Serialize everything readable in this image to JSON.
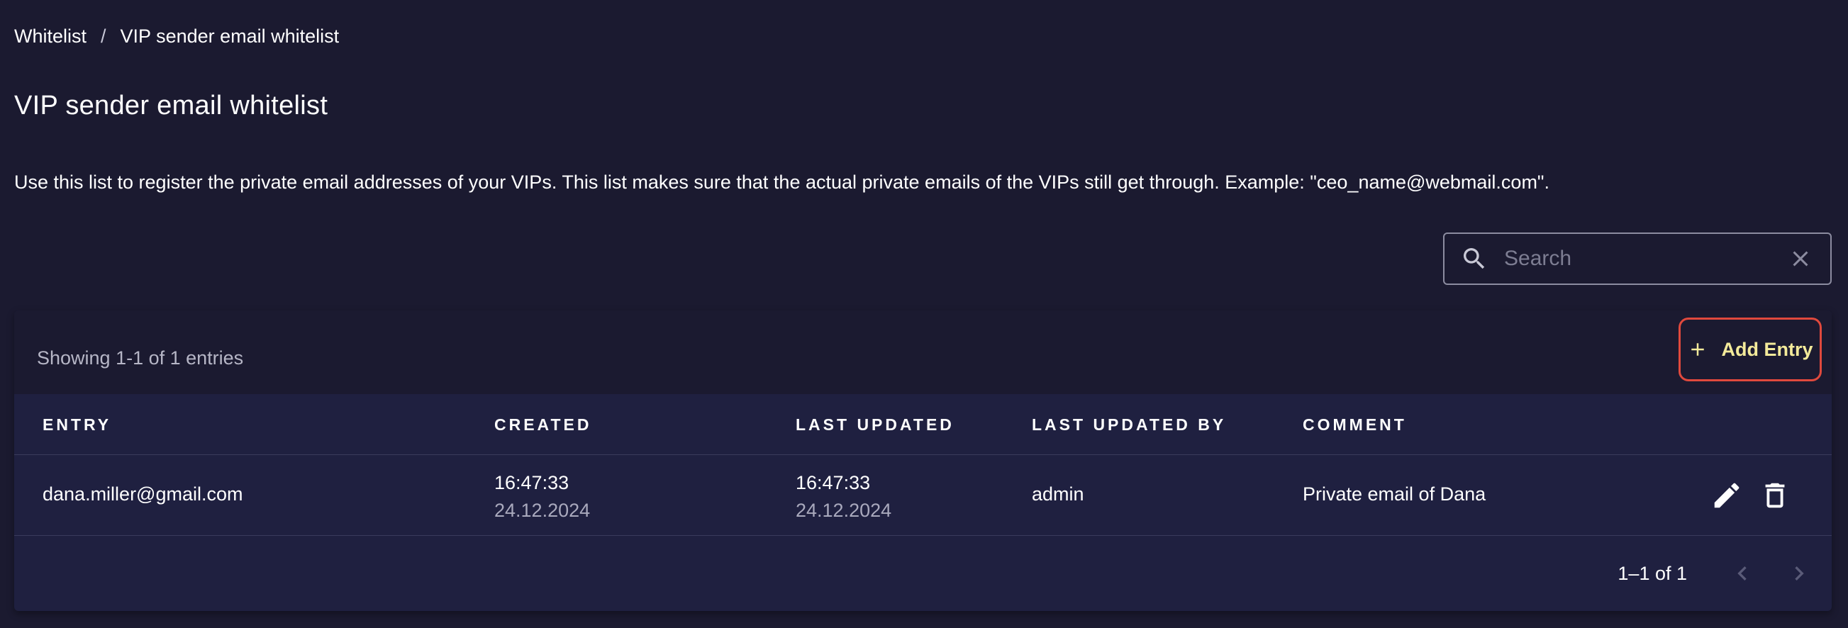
{
  "breadcrumb": {
    "items": [
      "Whitelist",
      "VIP sender email whitelist"
    ],
    "separator": "/"
  },
  "page": {
    "title": "VIP sender email whitelist",
    "description": "Use this list to register the private email addresses of your VIPs. This list makes sure that the actual private emails of the VIPs still get through. Example: \"ceo_name@webmail.com\"."
  },
  "search": {
    "placeholder": "Search",
    "value": "",
    "icon": "search-icon",
    "clear_icon": "close-icon"
  },
  "table": {
    "showing_text": "Showing 1-1 of 1 entries",
    "add_button_label": "Add Entry",
    "columns": [
      "ENTRY",
      "CREATED",
      "LAST UPDATED",
      "LAST UPDATED BY",
      "COMMENT"
    ],
    "rows": [
      {
        "entry": "dana.miller@gmail.com",
        "created_time": "16:47:33",
        "created_date": "24.12.2024",
        "updated_time": "16:47:33",
        "updated_date": "24.12.2024",
        "updated_by": "admin",
        "comment": "Private email of Dana"
      }
    ],
    "pagination": {
      "range": "1–1 of 1"
    }
  },
  "colors": {
    "background": "#1b1a30",
    "card": "#1f2040",
    "accent_text": "#f3ea9a",
    "highlight_border": "#e0493d",
    "muted_text": "#a9a9bd"
  }
}
